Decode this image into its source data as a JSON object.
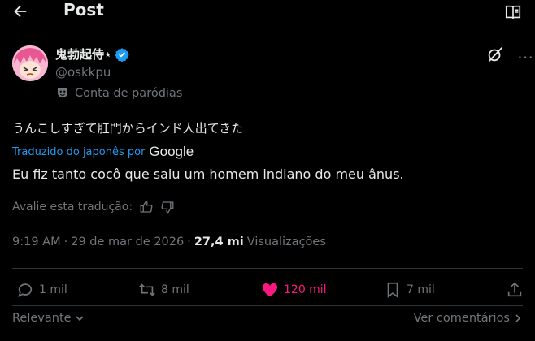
{
  "header": {
    "title": "Post"
  },
  "author": {
    "display_name": "鬼勃起侍⋆",
    "handle": "@oskkpu",
    "parody_label": "Conta de paródias"
  },
  "post": {
    "original_text": "うんこしすぎて肛門からインド人出てきた",
    "translated_from": "Traduzido do japonês por",
    "translator": "Google",
    "translation": "Eu fiz tanto cocô que saiu um homem indiano do meu ânus.",
    "rate_label": "Avalie esta tradução:",
    "time": "9:19 AM",
    "separator": "·",
    "date": "29 de mar de 2026",
    "views_count": "27,4 mi",
    "views_label": "Visualizações"
  },
  "actions": {
    "replies": "1 mil",
    "reposts": "8 mil",
    "likes": "120 mil",
    "bookmarks": "7 mil"
  },
  "footer": {
    "sort_label": "Relevante",
    "see_comments": "Ver comentários"
  },
  "colors": {
    "background": "#000000",
    "text": "#e7e9ea",
    "muted": "#71767b",
    "accent": "#1d9bf0",
    "like": "#f91880"
  }
}
